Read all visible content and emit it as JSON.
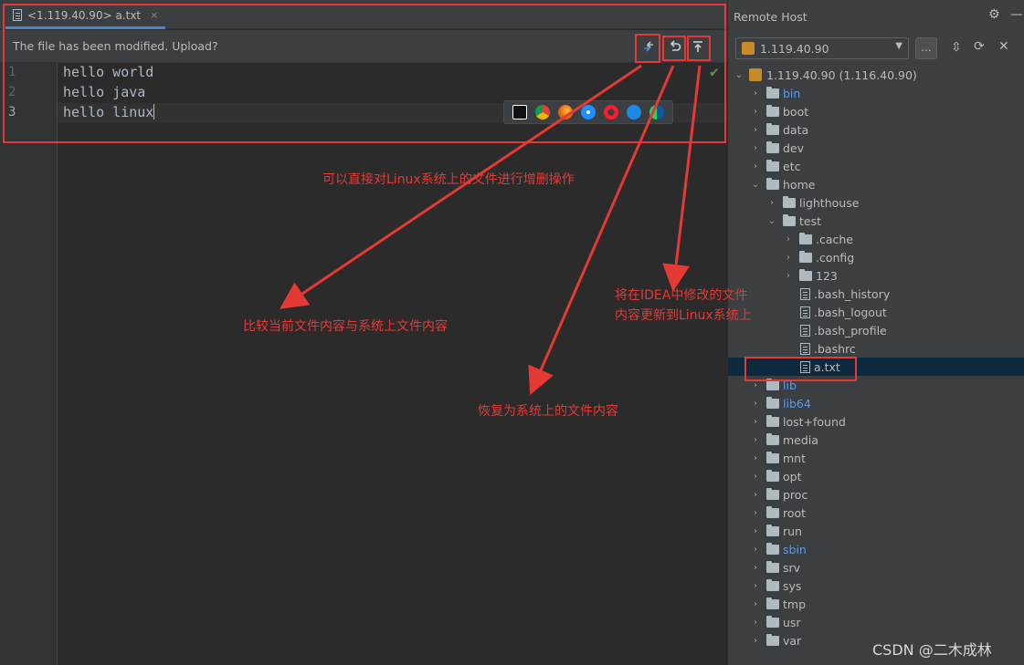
{
  "editor": {
    "tab_label": "<1.119.40.90> a.txt",
    "tab_close": "×",
    "notice_text": "The file has been modified. Upload?",
    "lines": [
      {
        "no": "1",
        "text": "hello world"
      },
      {
        "no": "2",
        "text": "hello java"
      },
      {
        "no": "3",
        "text": "hello linux"
      }
    ],
    "browsers": [
      "intellij-icon",
      "chrome-icon",
      "firefox-icon",
      "safari-icon",
      "opera-icon",
      "ie-icon",
      "edge-icon"
    ]
  },
  "annotations": {
    "a1": "可以直接对Linux系统上的文件进行增删操作",
    "a2": "比较当前文件内容与系统上文件内容",
    "a3": "恢复为系统上的文件内容",
    "a4_line1": "将在IDEA中修改的文件",
    "a4_line2": "内容更新到Linux系统上",
    "color": "#e53935"
  },
  "panel": {
    "title": "Remote Host",
    "host": "1.119.40.90",
    "more_label": "...",
    "root_label": "1.119.40.90 (1.116.40.90)",
    "tree": [
      {
        "label": "bin",
        "type": "folder",
        "depth": 1,
        "chev": "›",
        "blue": true
      },
      {
        "label": "boot",
        "type": "folder",
        "depth": 1,
        "chev": "›"
      },
      {
        "label": "data",
        "type": "folder",
        "depth": 1,
        "chev": "›"
      },
      {
        "label": "dev",
        "type": "folder",
        "depth": 1,
        "chev": "›"
      },
      {
        "label": "etc",
        "type": "folder",
        "depth": 1,
        "chev": "›"
      },
      {
        "label": "home",
        "type": "folder",
        "depth": 1,
        "chev": "⌄"
      },
      {
        "label": "lighthouse",
        "type": "folder",
        "depth": 2,
        "chev": "›"
      },
      {
        "label": "test",
        "type": "folder",
        "depth": 2,
        "chev": "⌄"
      },
      {
        "label": ".cache",
        "type": "folder",
        "depth": 3,
        "chev": "›"
      },
      {
        "label": ".config",
        "type": "folder",
        "depth": 3,
        "chev": "›"
      },
      {
        "label": "123",
        "type": "folder",
        "depth": 3,
        "chev": "›"
      },
      {
        "label": ".bash_history",
        "type": "file",
        "depth": 3
      },
      {
        "label": ".bash_logout",
        "type": "file",
        "depth": 3
      },
      {
        "label": ".bash_profile",
        "type": "file",
        "depth": 3
      },
      {
        "label": ".bashrc",
        "type": "file",
        "depth": 3
      },
      {
        "label": "a.txt",
        "type": "file",
        "depth": 3,
        "selected": true
      },
      {
        "label": "lib",
        "type": "folder",
        "depth": 1,
        "chev": "›",
        "blue": true
      },
      {
        "label": "lib64",
        "type": "folder",
        "depth": 1,
        "chev": "›",
        "blue": true
      },
      {
        "label": "lost+found",
        "type": "folder",
        "depth": 1,
        "chev": "›"
      },
      {
        "label": "media",
        "type": "folder",
        "depth": 1,
        "chev": "›"
      },
      {
        "label": "mnt",
        "type": "folder",
        "depth": 1,
        "chev": "›"
      },
      {
        "label": "opt",
        "type": "folder",
        "depth": 1,
        "chev": "›"
      },
      {
        "label": "proc",
        "type": "folder",
        "depth": 1,
        "chev": "›"
      },
      {
        "label": "root",
        "type": "folder",
        "depth": 1,
        "chev": "›"
      },
      {
        "label": "run",
        "type": "folder",
        "depth": 1,
        "chev": "›"
      },
      {
        "label": "sbin",
        "type": "folder",
        "depth": 1,
        "chev": "›",
        "blue": true
      },
      {
        "label": "srv",
        "type": "folder",
        "depth": 1,
        "chev": "›"
      },
      {
        "label": "sys",
        "type": "folder",
        "depth": 1,
        "chev": "›"
      },
      {
        "label": "tmp",
        "type": "folder",
        "depth": 1,
        "chev": "›"
      },
      {
        "label": "usr",
        "type": "folder",
        "depth": 1,
        "chev": "›"
      },
      {
        "label": "var",
        "type": "folder",
        "depth": 1,
        "chev": "›"
      }
    ]
  },
  "watermark": "CSDN @二木成林"
}
